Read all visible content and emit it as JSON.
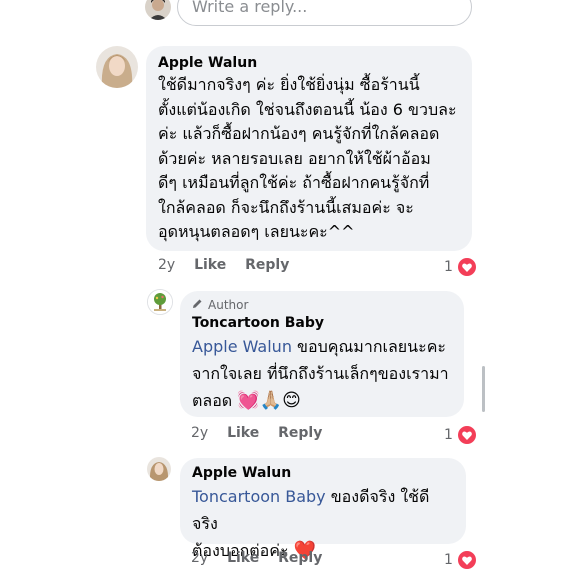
{
  "reply_box": {
    "placeholder": "Write a reply..."
  },
  "comments": [
    {
      "author": "Apple Walun",
      "text": "ใช้ดีมากจริงๆ ค่ะ ยิ่งใช้ยิ่งนุ่ม ซื้อร้านนี้ตั้งแต่น้องเกิด ใช่จนถึงตอนนี้ น้อง 6 ขวบละค่ะ แล้วก็ซื้อฝากน้องๆ คนรู้จักที่ใกล้คลอดด้วยค่ะ หลายรอบเลย อยากให้ใช้ผ้าอ้อมดีๆ เหมือนที่ลูกใช้ค่ะ ถ้าซื้อฝากคนรู้จักที่ใกล้คลอด ก็จะนึกถึงร้านนี้เสมอค่ะ จะอุดหนุนตลอดๆ เลยนะคะ^^",
      "lines": [
        "ใช้ดีมากจริงๆ ค่ะ ยิ่งใช้ยิ่งนุ่ม ซื้อร้านนี้",
        "ตั้งแต่น้องเกิด ใช่จนถึงตอนนี้ น้อง 6 ขวบละ",
        "ค่ะ แล้วก็ซื้อฝากน้องๆ คนรู้จักที่ใกล้คลอด",
        "ด้วยค่ะ หลายรอบเลย อยากให้ใช้ผ้าอ้อม",
        "ดีๆ เหมือนที่ลูกใช้ค่ะ ถ้าซื้อฝากคนรู้จักที่",
        "ใกล้คลอด ก็จะนึกถึงร้านนี้เสมอค่ะ จะ",
        "อุดหนุนตลอดๆ เลยนะคะ^^"
      ],
      "time": "2y",
      "like": "Like",
      "reply": "Reply",
      "reactions": "1"
    },
    {
      "author_tag": "Author",
      "author": "Toncartoon Baby",
      "mention": "Apple Walun",
      "line1_rest": " ขอบคุณมากเลยนะคะ",
      "line2": "จากใจเลย ที่นึกถึงร้านเล็กๆของเรามา",
      "line3": "ตลอด",
      "emojis": "💓🙏🏼😊",
      "time": "2y",
      "like": "Like",
      "reply": "Reply",
      "reactions": "1"
    },
    {
      "author": "Apple Walun",
      "mention": "Toncartoon Baby",
      "line1_rest": " ของดีจริง ใช้ดีจริง",
      "line2": "ต้องบอกต่อค่ะ",
      "emoji": "❤️",
      "time": "2y",
      "like": "Like",
      "reply": "Reply",
      "reactions": "1"
    }
  ],
  "colors": {
    "bubble": "#f0f2f5",
    "link": "#385898",
    "heart": "#f33e58",
    "meta": "#65676b"
  }
}
